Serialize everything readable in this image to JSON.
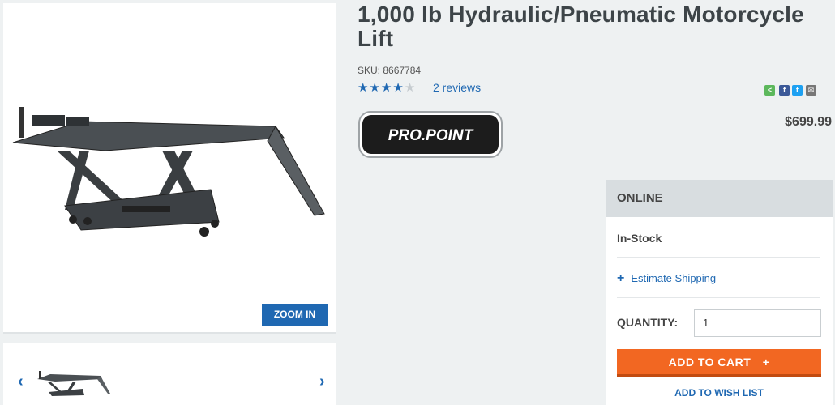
{
  "product": {
    "title": "1,000 lb Hydraulic/Pneumatic Motorcycle Lift",
    "sku": "SKU: 8667784",
    "rating": 4,
    "rating_max": 5,
    "reviews_label": "2 reviews",
    "price": "$699.99",
    "brand": "PRO.POINT"
  },
  "gallery": {
    "zoom_label": "ZOOM IN",
    "prev_icon": "chevron-left-icon",
    "next_icon": "chevron-right-icon"
  },
  "share": {
    "icons": [
      "share-icon",
      "facebook-icon",
      "twitter-icon",
      "email-icon"
    ],
    "colors": [
      "#5cb85c",
      "#3b5998",
      "#1da1f2",
      "#777777"
    ]
  },
  "purchase": {
    "channel": "ONLINE",
    "stock_status": "In-Stock",
    "estimate_shipping": "Estimate Shipping",
    "quantity_label": "QUANTITY:",
    "quantity_value": "1",
    "add_to_cart": "ADD TO CART",
    "add_to_wishlist": "ADD TO WISH LIST"
  },
  "colors": {
    "accent_blue": "#1f68b2",
    "cart_orange": "#f26722"
  }
}
